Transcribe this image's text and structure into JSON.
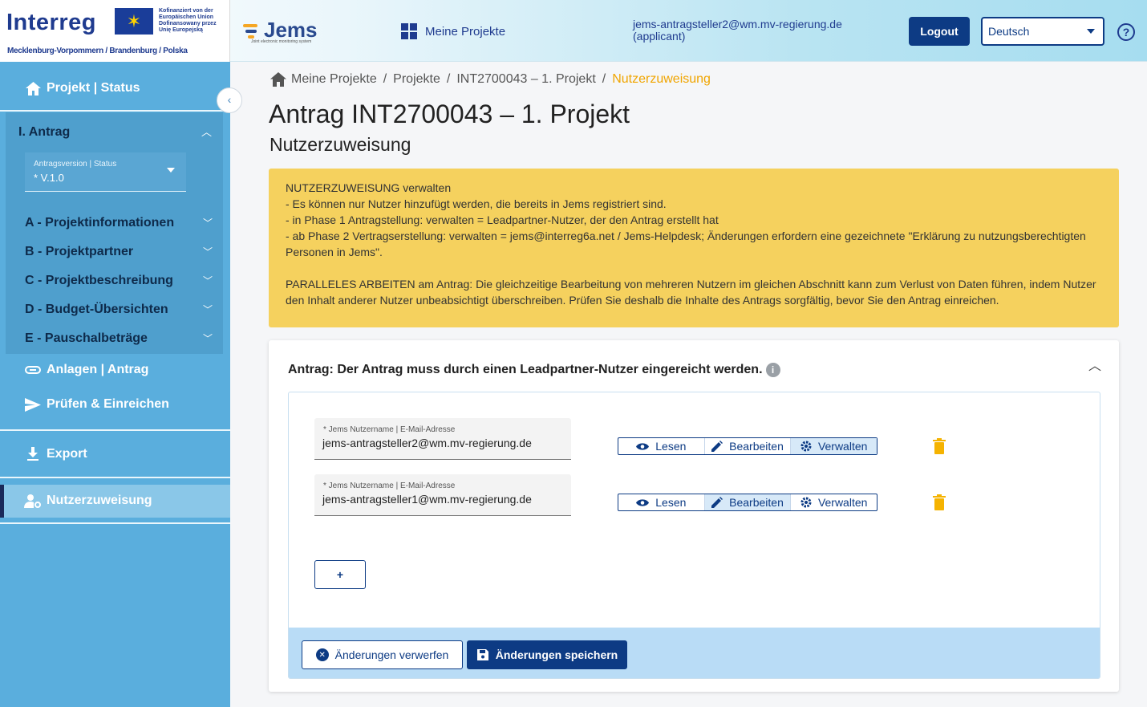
{
  "header": {
    "logo_text": "Interreg",
    "eu_text": "Kofinanziert von der Europäischen Union Dofinansowany przez Unię Europejską",
    "region_text": "Mecklenburg-Vorpommern / Brandenburg / Polska",
    "jems_name": "Jems",
    "jems_tagline": "Joint electronic monitoring system",
    "my_projects_label": "Meine Projekte",
    "user_email": "jems-antragsteller2@wm.mv-regierung.de",
    "user_role": "(applicant)",
    "logout_label": "Logout",
    "language_value": "Deutsch",
    "help_glyph": "?"
  },
  "sidebar": {
    "project_status_label": "Projekt | Status",
    "antrag_label": "I. Antrag",
    "version_label": "Antragsversion | Status",
    "version_value": "* V.1.0",
    "sections": [
      {
        "label": "A - Projektinformationen"
      },
      {
        "label": "B - Projektpartner"
      },
      {
        "label": "C - Projektbeschreibung"
      },
      {
        "label": "D - Budget-Übersichten"
      },
      {
        "label": "E - Pauschalbeträge"
      }
    ],
    "attachments_label": "Anlagen | Antrag",
    "check_submit_label": "Prüfen & Einreichen",
    "export_label": "Export",
    "user_assignment_label": "Nutzerzuweisung",
    "collapse_glyph": "‹"
  },
  "breadcrumb": {
    "items": [
      "Meine Projekte",
      "Projekte",
      "INT2700043 – 1. Projekt"
    ],
    "current": "Nutzerzuweisung",
    "separator": "/"
  },
  "page": {
    "title": "Antrag INT2700043 – 1. Projekt",
    "subtitle": "Nutzerzuweisung"
  },
  "alert": {
    "lines": [
      "NUTZERZUWEISUNG verwalten",
      "- Es können nur Nutzer hinzufügt werden, die bereits in Jems registriert sind.",
      "- in Phase 1 Antragstellung: verwalten = Leadpartner-Nutzer, der den Antrag erstellt hat",
      "- ab Phase 2 Vertragserstellung: verwalten = jems@interreg6a.net / Jems-Helpdesk; Änderungen erfordern eine gezeichnete \"Erklärung zu nutzungsberechtigten Personen in Jems\"."
    ],
    "paragraph2": "PARALLELES ARBEITEN am Antrag: Die gleichzeitige Bearbeitung von mehreren Nutzern im gleichen Abschnitt kann zum Verlust von Daten führen, indem Nutzer den Inhalt anderer Nutzer unbeabsichtigt überschreiben. Prüfen Sie deshalb die Inhalte des Antrags sorgfältig, bevor Sie den Antrag einreichen."
  },
  "card": {
    "title": "Antrag: Der Antrag muss durch einen Leadpartner-Nutzer eingereicht werden.",
    "info_glyph": "i",
    "field_label": "* Jems Nutzername | E-Mail-Adresse",
    "users": [
      {
        "email": "jems-antragsteller2@wm.mv-regierung.de",
        "permission": "Verwalten"
      },
      {
        "email": "jems-antragsteller1@wm.mv-regierung.de",
        "permission": "Bearbeiten"
      }
    ],
    "permission_options": [
      "Lesen",
      "Bearbeiten",
      "Verwalten"
    ],
    "add_label": "+",
    "discard_label": "Änderungen verwerfen",
    "save_label": "Änderungen speichern"
  },
  "colors": {
    "primary": "#0d3b84",
    "sidebar": "#5aaedd",
    "alert": "#f5d15e",
    "accent": "#f0a500",
    "active_permission": "#d7e9f8"
  }
}
